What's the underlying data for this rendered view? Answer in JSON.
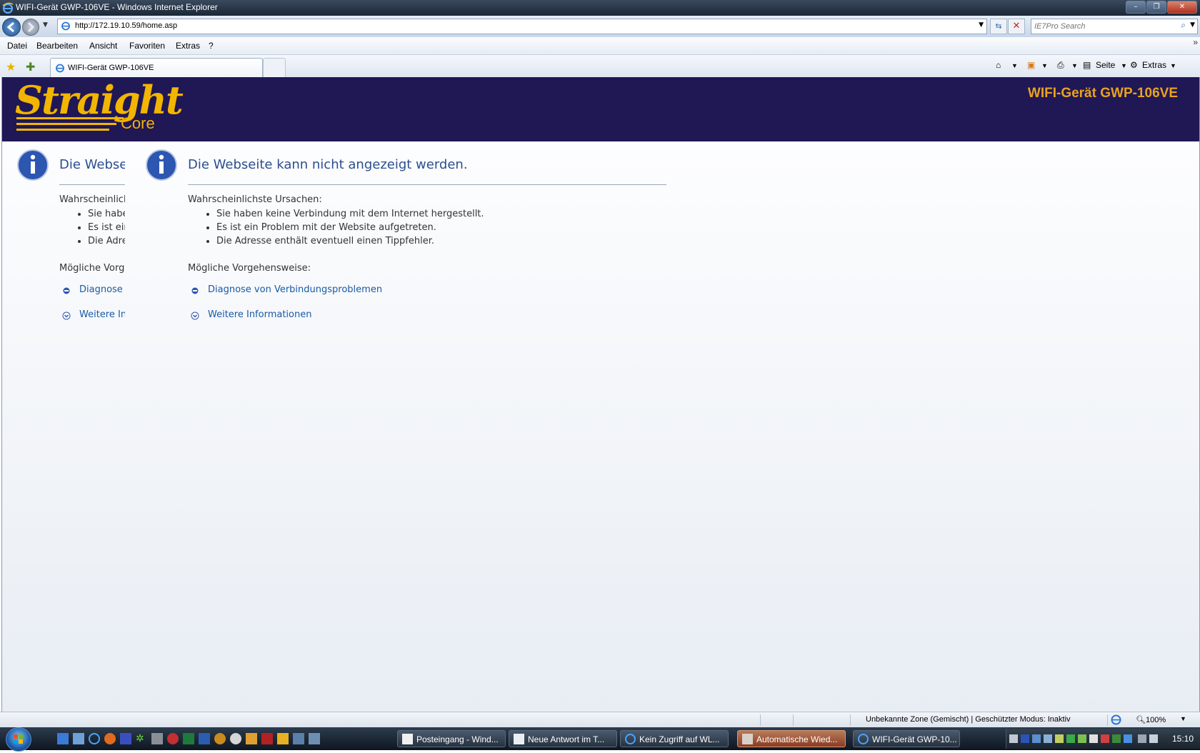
{
  "window": {
    "title": "WIFI-Gerät GWP-106VE - Windows Internet Explorer",
    "min_glyph": "–",
    "max_glyph": "❐",
    "close_glyph": "✕"
  },
  "address": {
    "url": "http://172.19.10.59/home.asp",
    "search_placeholder": "IE7Pro Search"
  },
  "menu": [
    "Datei",
    "Bearbeiten",
    "Ansicht",
    "Favoriten",
    "Extras",
    "?"
  ],
  "tab": {
    "label": "WIFI-Gerät GWP-106VE"
  },
  "commandbar": {
    "page": "Seite",
    "tools": "Extras"
  },
  "banner": {
    "logo_main": "Straight",
    "logo_sub": "Core",
    "device_title": "WIFI-Gerät GWP-106VE"
  },
  "error": {
    "heading": "Die Webseite kann nicht angezeigt werden.",
    "causes_title": "Wahrscheinlichste Ursachen:",
    "causes": [
      "Sie haben keine Verbindung mit dem Internet hergestellt.",
      "Es ist ein Problem mit der Website aufgetreten.",
      "Die Adresse enthält eventuell einen Tippfehler."
    ],
    "steps_title": "Mögliche Vorgehensweise:",
    "links": [
      "Diagnose von Verbindungsproblemen",
      "Weitere Informationen"
    ]
  },
  "statusbar": {
    "zone": "Unbekannte Zone (Gemischt) | Geschützter Modus: Inaktiv",
    "zoom": "100%"
  },
  "taskbar": {
    "tasks": [
      "Posteingang - Wind...",
      "Neue Antwort im T...",
      "Kein Zugriff auf WL...",
      "Automatische Wied...",
      "WIFI-Gerät GWP-10..."
    ],
    "clock": "15:10"
  },
  "colors": {
    "banner_bg": "#201755",
    "logo_gold": "#f2b500",
    "device_title": "#e8a21e",
    "heading_blue": "#2b4f8f",
    "link_blue": "#1a5aa6"
  }
}
